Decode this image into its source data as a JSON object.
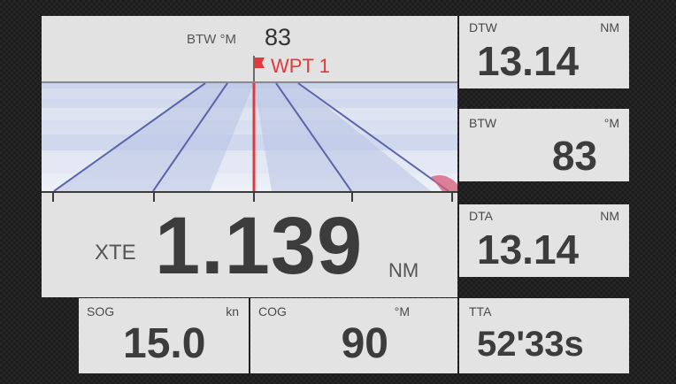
{
  "highway": {
    "btw_label": "BTW °M",
    "btw_value": "83",
    "waypoint": "WPT 1",
    "xte_label": "XTE",
    "xte_value": "1.139",
    "xte_unit": "NM"
  },
  "bottom": {
    "sog": {
      "label": "SOG",
      "unit": "kn",
      "value": "15.0"
    },
    "cog": {
      "label": "COG",
      "unit": "°M",
      "value": "90"
    }
  },
  "right": {
    "dtw": {
      "label": "DTW",
      "unit": "NM",
      "value": "13.14"
    },
    "btw": {
      "label": "BTW",
      "unit": "°M",
      "value": "83"
    },
    "dta": {
      "label": "DTA",
      "unit": "NM",
      "value": "13.14"
    },
    "tta": {
      "label": "TTA",
      "value": "52'33s"
    }
  },
  "colors": {
    "panel_bg": "#e3e3e3",
    "value_text": "#3c3c3c",
    "waypoint_red": "#e03a3a",
    "lane_blue": "#5a64a8"
  },
  "icons": {
    "waypoint": "waypoint-flag-icon"
  }
}
